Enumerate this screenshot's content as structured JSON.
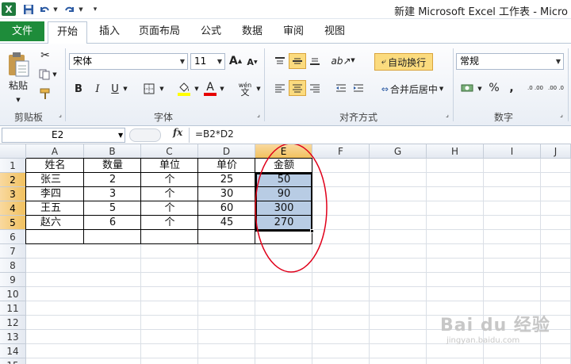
{
  "window": {
    "title": "新建 Microsoft Excel 工作表 - Micro",
    "quick_access": [
      "excel-app-icon",
      "save-icon",
      "undo-icon",
      "undo-dropdown-icon",
      "redo-icon",
      "redo-dropdown-icon",
      "customize-qat-icon"
    ]
  },
  "tabs": {
    "file": "文件",
    "items": [
      "开始",
      "插入",
      "页面布局",
      "公式",
      "数据",
      "审阅",
      "视图"
    ],
    "active": "开始"
  },
  "ribbon": {
    "clipboard": {
      "label": "剪贴板",
      "paste": "粘贴"
    },
    "font": {
      "label": "字体",
      "font_name": "宋体",
      "font_size": "11",
      "bold": "B",
      "italic": "I",
      "underline": "U",
      "font_color_glyph": "A",
      "phonetic": "wén"
    },
    "alignment": {
      "label": "对齐方式",
      "wrap_text": "自动换行",
      "merge_center": "合并后居中"
    },
    "number": {
      "label": "数字",
      "format": "常规",
      "percent": "%",
      "comma": ",",
      "increase_decimal": ".0 .00",
      "decrease_decimal": ".00 .0"
    }
  },
  "formula_bar": {
    "name_box": "E2",
    "fx": "fx",
    "formula": "=B2*D2"
  },
  "sheet": {
    "columns": [
      "A",
      "B",
      "C",
      "D",
      "E",
      "F",
      "G",
      "H",
      "I",
      "J"
    ],
    "rows": [
      "1",
      "2",
      "3",
      "4",
      "5",
      "6",
      "7",
      "8",
      "9",
      "10",
      "11",
      "12",
      "13",
      "14",
      "15"
    ],
    "active_column": "E",
    "active_rows": [
      "2",
      "3",
      "4",
      "5"
    ],
    "data": [
      [
        "姓名",
        "数量",
        "单位",
        "单价",
        "金额"
      ],
      [
        "张三",
        "2",
        "个",
        "25",
        "50"
      ],
      [
        "李四",
        "3",
        "个",
        "30",
        "90"
      ],
      [
        "王五",
        "5",
        "个",
        "60",
        "300"
      ],
      [
        "赵六",
        "6",
        "个",
        "45",
        "270"
      ]
    ],
    "selection": "E2:E5",
    "selection_fill": "#b8cce4",
    "annotation_color": "#e0001a"
  },
  "watermark": {
    "brand": "Bai du 经验",
    "url": "jingyan.baidu.com"
  },
  "colors": {
    "file_tab": "#1e8c3a",
    "highlight": "#fbdb7e",
    "header_active": "#f1c15f"
  }
}
